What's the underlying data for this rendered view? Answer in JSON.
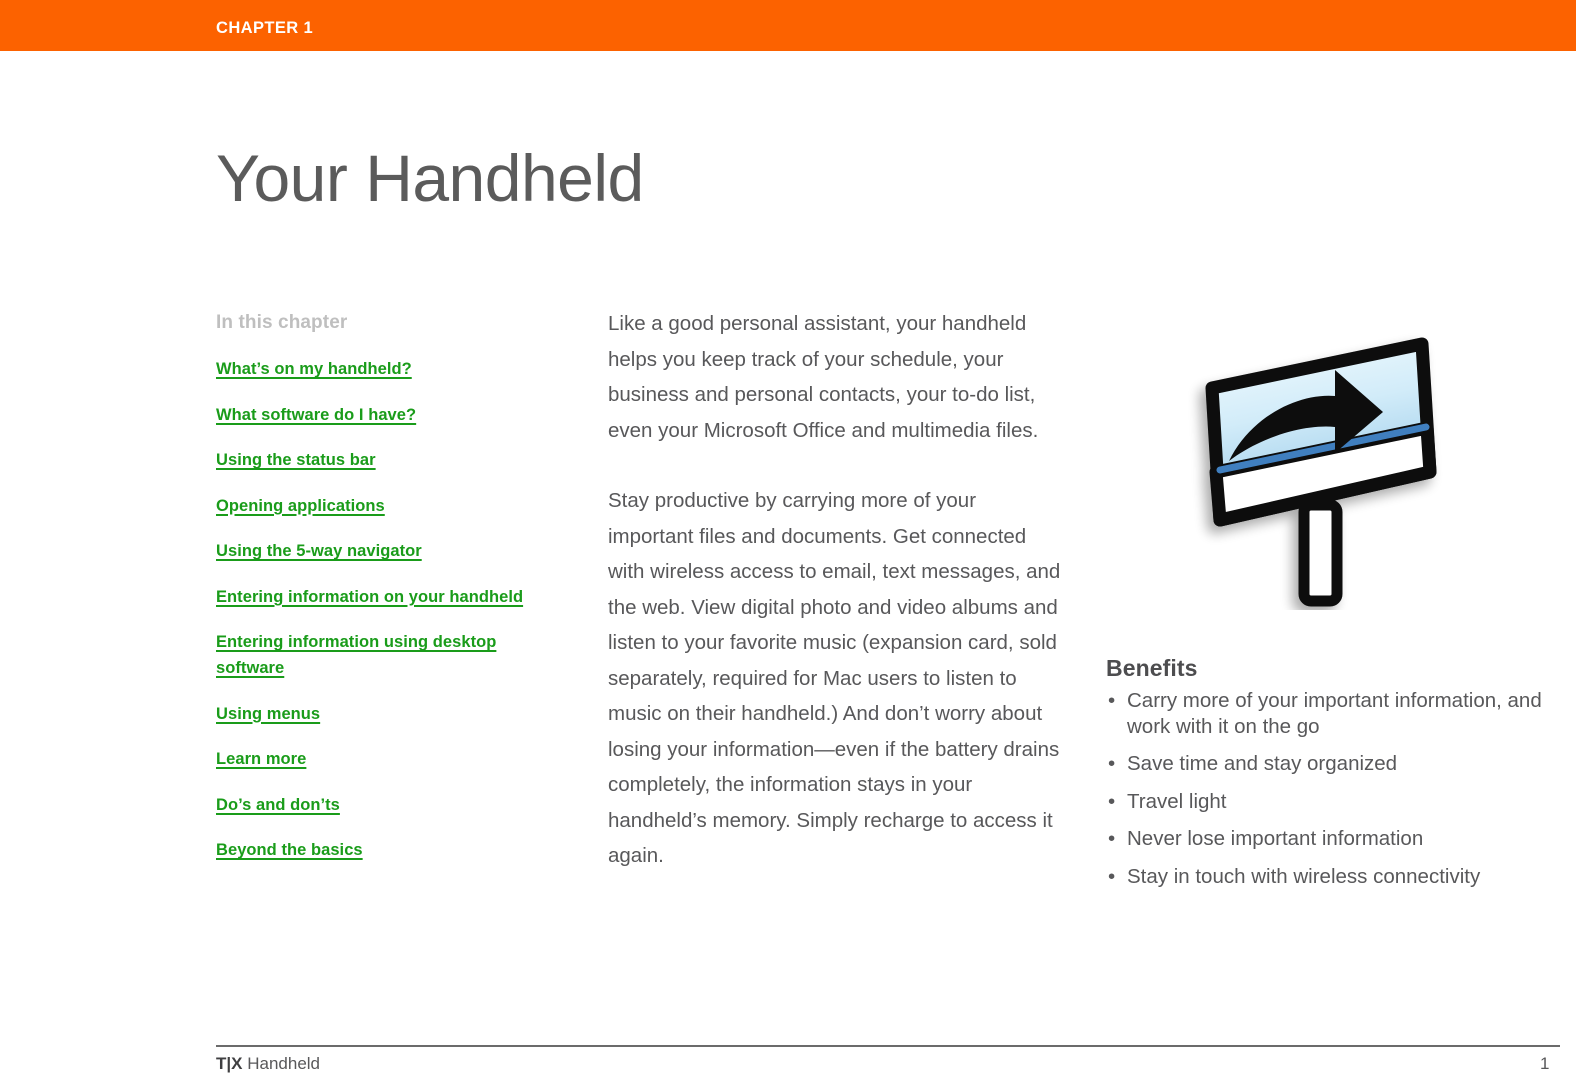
{
  "header": {
    "chapter_label": "CHAPTER 1",
    "bar_color": "#fc6200",
    "page_title": "Your Handheld",
    "title_color": "#5b5b5b"
  },
  "sidebar": {
    "heading": "In this chapter",
    "heading_color": "#bfbfbf",
    "link_color": "#1a9c1a",
    "links": [
      {
        "label": "What’s on my handheld?"
      },
      {
        "label": "What software do I have?"
      },
      {
        "label": "Using the status bar"
      },
      {
        "label": "Opening applications"
      },
      {
        "label": "Using the 5-way navigator"
      },
      {
        "label": "Entering information on your handheld"
      },
      {
        "label": "Entering information using desktop software"
      },
      {
        "label": "Using menus"
      },
      {
        "label": "Learn more"
      },
      {
        "label": "Do’s and don’ts"
      },
      {
        "label": "Beyond the basics"
      }
    ]
  },
  "body": {
    "text_color": "#58585a",
    "paragraphs": [
      "Like a good personal assistant, your handheld helps you keep track of your schedule, your business and personal contacts, your to-do list, even your Microsoft Office and multimedia files.",
      "Stay productive by carrying more of your important files and documents. Get connected with wireless access to email, text messages, and the web. View digital photo and video albums and listen to your favorite music (expansion card, sold separately, required for Mac users to listen to music on their handheld.) And don’t worry about losing your information—even if the battery drains completely, the information stays in your handheld’s memory. Simply recharge to access it again."
    ]
  },
  "illustration": {
    "name": "signpost-arrow-illustration",
    "description": "Billboard sign on a post with a curved arrow pointing right",
    "screen_gradient_top": "#eaf7fd",
    "screen_gradient_bottom": "#9ecdea",
    "accent_line_color": "#3f7fbf",
    "outline_color": "#000000"
  },
  "benefits": {
    "heading": "Benefits",
    "bullet_glyph": "•",
    "items": [
      "Carry more of your important information, and work with it on the go",
      "Save time and stay organized",
      "Travel light",
      "Never lose important information",
      "Stay in touch with wireless connectivity"
    ]
  },
  "footer": {
    "brand": "T|X",
    "product": "Handheld",
    "page_number": "1",
    "rule_color": "#6b6b6b"
  }
}
